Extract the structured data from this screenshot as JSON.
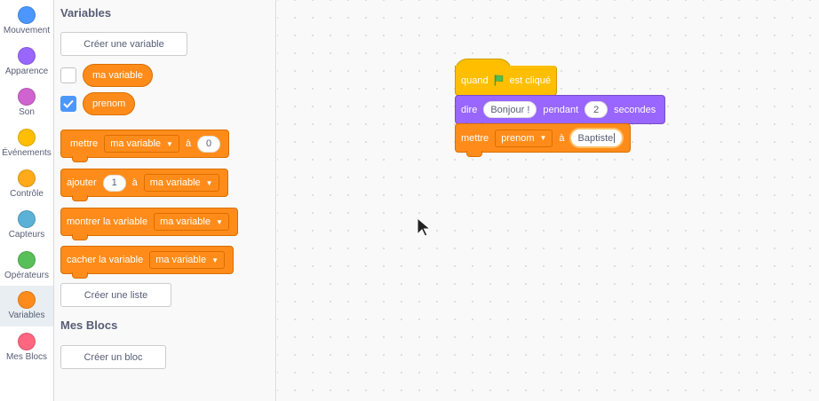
{
  "categories": [
    {
      "label": "Mouvement",
      "color": "#4c97ff"
    },
    {
      "label": "Apparence",
      "color": "#9966ff"
    },
    {
      "label": "Son",
      "color": "#cf63cf"
    },
    {
      "label": "Événements",
      "color": "#ffbf00"
    },
    {
      "label": "Contrôle",
      "color": "#ffab19"
    },
    {
      "label": "Capteurs",
      "color": "#5cb1d6"
    },
    {
      "label": "Opérateurs",
      "color": "#59c059"
    },
    {
      "label": "Variables",
      "color": "#ff8c1a"
    },
    {
      "label": "Mes Blocs",
      "color": "#ff6680"
    }
  ],
  "palette": {
    "variables_title": "Variables",
    "create_variable": "Créer une variable",
    "variables": [
      {
        "name": "ma variable",
        "checked": false
      },
      {
        "name": "prenom",
        "checked": true
      }
    ],
    "blocks": {
      "set": {
        "w1": "mettre",
        "dd": "ma variable",
        "w2": "à",
        "val": "0"
      },
      "change": {
        "w1": "ajouter",
        "val": "1",
        "w2": "à",
        "dd": "ma variable"
      },
      "show": {
        "w1": "montrer la variable",
        "dd": "ma variable"
      },
      "hide": {
        "w1": "cacher la variable",
        "dd": "ma variable"
      }
    },
    "create_list": "Créer une liste",
    "my_blocks_title": "Mes Blocs",
    "create_block": "Créer un bloc"
  },
  "script": {
    "hat": {
      "w1": "quand",
      "w2": "est cliqué"
    },
    "say": {
      "w1": "dire",
      "msg": "Bonjour !",
      "w2": "pendant",
      "secs": "2",
      "w3": "secondes"
    },
    "set": {
      "w1": "mettre",
      "dd": "prenom",
      "w2": "à",
      "val": "Baptiste"
    }
  },
  "colors": {
    "variables": "#ff8c1a",
    "looks": "#9966ff",
    "events": "#ffbf00",
    "selected_category_bg": "#e9eef2"
  }
}
